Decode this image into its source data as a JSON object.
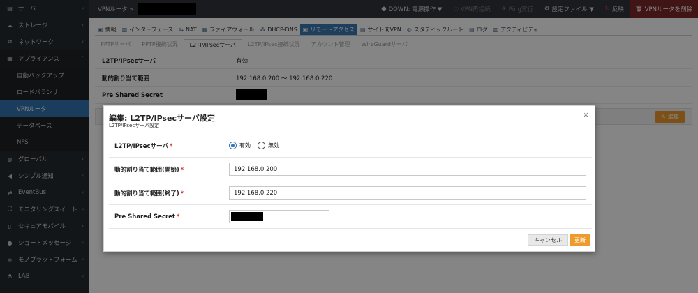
{
  "sidebar": {
    "items": [
      {
        "label": "サーバ",
        "icon": "server-icon",
        "glyph": "▤",
        "chevron": "‹",
        "kind": "parent"
      },
      {
        "label": "ストレージ",
        "icon": "cloud-icon",
        "glyph": "☁",
        "chevron": "‹",
        "kind": "parent"
      },
      {
        "label": "ネットワーク",
        "icon": "network-icon",
        "glyph": "⧉",
        "chevron": "‹",
        "kind": "parent"
      },
      {
        "label": "アプライアンス",
        "icon": "appliance-icon",
        "glyph": "▦",
        "chevron": "˄",
        "kind": "parent-open"
      },
      {
        "label": "自動バックアップ",
        "kind": "sub"
      },
      {
        "label": "ロードバランサ",
        "kind": "sub"
      },
      {
        "label": "VPNルータ",
        "kind": "sub-active"
      },
      {
        "label": "データベース",
        "kind": "sub"
      },
      {
        "label": "NFS",
        "kind": "sub"
      },
      {
        "label": "グローバル",
        "icon": "globe-icon",
        "glyph": "◍",
        "chevron": "‹",
        "kind": "parent"
      },
      {
        "label": "シンプル通知",
        "icon": "megaphone-icon",
        "glyph": "◀",
        "chevron": "‹",
        "kind": "parent"
      },
      {
        "label": "EventBus",
        "icon": "eventbus-icon",
        "glyph": "⇄",
        "chevron": "‹",
        "kind": "parent"
      },
      {
        "label": "モニタリングスイート",
        "icon": "binoculars-icon",
        "glyph": "⛶",
        "chevron": "‹",
        "kind": "parent"
      },
      {
        "label": "セキュアモバイル",
        "icon": "mobile-icon",
        "glyph": "▯",
        "chevron": "‹",
        "kind": "parent"
      },
      {
        "label": "ショートメッセージ",
        "icon": "chat-icon",
        "glyph": "●",
        "chevron": "‹",
        "kind": "parent"
      },
      {
        "label": "モノプラットフォーム",
        "icon": "list-icon",
        "glyph": "≡",
        "chevron": "‹",
        "kind": "parent"
      },
      {
        "label": "LAB",
        "icon": "flask-icon",
        "glyph": "⚗",
        "chevron": "‹",
        "kind": "parent"
      }
    ]
  },
  "topbar": {
    "crumb": "VPNルータ »",
    "actions": [
      {
        "name": "power-action",
        "icon": "power-icon",
        "glyph": "●",
        "label": "DOWN: 電源操作 ▼",
        "state": "normal"
      },
      {
        "name": "vpn-reconnect-action",
        "icon": "link-icon",
        "glyph": "◌",
        "label": "VPN再接続",
        "state": "disabled"
      },
      {
        "name": "ping-action",
        "icon": "plane-icon",
        "glyph": "✈",
        "label": "Ping実行",
        "state": "disabled"
      },
      {
        "name": "config-file-action",
        "icon": "gear-icon",
        "glyph": "⚙",
        "label": "設定ファイル ▼",
        "state": "normal"
      },
      {
        "name": "apply-action",
        "icon": "refresh-icon",
        "glyph": "↻",
        "label": "反映",
        "state": "red"
      },
      {
        "name": "delete-vpn-action",
        "icon": "trash-icon",
        "glyph": "🗑",
        "label": "VPNルータを削除",
        "state": "danger"
      }
    ]
  },
  "tabs_primary": [
    {
      "name": "tab-info",
      "icon": "info-icon",
      "glyph": "▣",
      "label": "情報"
    },
    {
      "name": "tab-interface",
      "icon": "interface-icon",
      "glyph": "▥",
      "label": "インターフェース"
    },
    {
      "name": "tab-nat",
      "icon": "nat-icon",
      "glyph": "⇆",
      "label": "NAT"
    },
    {
      "name": "tab-firewall",
      "icon": "firewall-icon",
      "glyph": "▦",
      "label": "ファイアウォール"
    },
    {
      "name": "tab-dhcp-dns",
      "icon": "dhcp-icon",
      "glyph": "⁂",
      "label": "DHCP-DNS"
    },
    {
      "name": "tab-remote-access",
      "icon": "remote-icon",
      "glyph": "▣",
      "label": "リモートアクセス",
      "active": true
    },
    {
      "name": "tab-site-vpn",
      "icon": "site-vpn-icon",
      "glyph": "▤",
      "label": "サイト間VPN"
    },
    {
      "name": "tab-static-route",
      "icon": "route-icon",
      "glyph": "◎",
      "label": "スタティックルート"
    },
    {
      "name": "tab-log",
      "icon": "log-icon",
      "glyph": "▤",
      "label": "ログ"
    },
    {
      "name": "tab-activity",
      "icon": "activity-icon",
      "glyph": "▥",
      "label": "アクティビティ"
    }
  ],
  "tabs_secondary": [
    {
      "name": "subtab-pptp-server",
      "label": "PPTPサーバ"
    },
    {
      "name": "subtab-pptp-status",
      "label": "PPTP接続状況"
    },
    {
      "name": "subtab-l2tp-server",
      "label": "L2TP/IPsecサーバ",
      "active": true
    },
    {
      "name": "subtab-l2tp-status",
      "label": "L2TP/IPsec接続状況"
    },
    {
      "name": "subtab-accounts",
      "label": "アカウント管理"
    },
    {
      "name": "subtab-wireguard",
      "label": "WireGuardサーバ"
    }
  ],
  "detail": {
    "server_label": "L2TP/IPsecサーバ",
    "server_value": "有効",
    "range_label": "動的割り当て範囲",
    "range_value": "192.168.0.200 ～ 192.168.0.220",
    "psk_label": "Pre Shared Secret",
    "edit_label": "編集"
  },
  "modal": {
    "title": "編集: L2TP/IPsecサーバ設定",
    "subtitle": "L2TP/IPsecサーバ設定",
    "close": "×",
    "server_label": "L2TP/IPsecサーバ",
    "required_mark": "*",
    "opt_enable": "有効",
    "opt_disable": "無効",
    "range_start_label": "動的割り当て範囲(開始)",
    "range_start_value": "192.168.0.200",
    "range_end_label": "動的割り当て範囲(終了)",
    "range_end_value": "192.168.0.220",
    "psk_label": "Pre Shared Secret",
    "cancel_label": "キャンセル",
    "save_label": "更新"
  }
}
